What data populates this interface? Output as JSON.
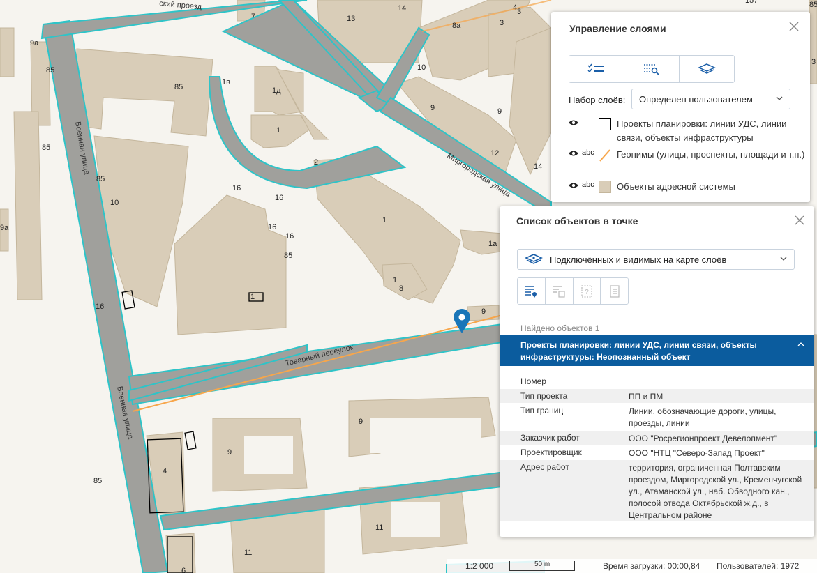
{
  "map": {
    "streets": [
      "Военная улица",
      "Военная улица",
      "Товарный переулок",
      "Миргородская улица",
      "ский проезд"
    ],
    "house_numbers": [
      "7",
      "13",
      "14",
      "8а",
      "3",
      "4",
      "3",
      "157",
      "9а",
      "85",
      "85",
      "85",
      "85",
      "16",
      "1в",
      "1д",
      "1",
      "2",
      "10",
      "16",
      "16",
      "16",
      "16",
      "85",
      "1",
      "1",
      "1",
      "8",
      "10",
      "9",
      "9",
      "12",
      "14",
      "1а",
      "9",
      "85",
      "9",
      "9",
      "4",
      "85",
      "11",
      "11",
      "6",
      "9а",
      "3"
    ]
  },
  "layers_panel": {
    "title": "Управление слоями",
    "set_label": "Набор слоёв:",
    "set_value": "Определен пользователем",
    "tools": [
      "checklist-icon",
      "filter-search-icon",
      "layers-icon"
    ],
    "layers": [
      {
        "label": "Проекты планировки: линии УДС, линии связи, объекты инфраструктуры",
        "abc": "",
        "legend_color": "#000000"
      },
      {
        "label": "Геонимы (улицы, проспекты, площади и т.п.)",
        "abc": "abc",
        "legend_color": "#f7a64b"
      },
      {
        "label": "Объекты адресной системы",
        "abc": "abc",
        "legend_color": "#d9cdb8"
      }
    ]
  },
  "objects_panel": {
    "title": "Список объектов в точке",
    "source_value": "Подключённых и видимых на карте слоёв",
    "found_label": "Найдено объектов 1",
    "result_header": "Проекты планировки: линии УДС, линии связи, объекты инфраструктуры: Неопознанный объект",
    "attributes": [
      {
        "key": "Номер",
        "value": ""
      },
      {
        "key": "Тип проекта",
        "value": "ПП и ПМ"
      },
      {
        "key": "Тип границ",
        "value": "Линии, обозначающие дороги, улицы, проезды, линии"
      },
      {
        "key": "Заказчик работ",
        "value": "ООО \"Росрегионпроект Девелопмент\""
      },
      {
        "key": "Проектировщик",
        "value": "ООО \"НТЦ \"Северо-Запад Проект\""
      },
      {
        "key": "Адрес работ",
        "value": "территория, ограниченная Полтавским проездом, Миргородской ул., Кременчугской ул., Атаманской ул., наб. Обводного кан., полосой отвода Октябрьской ж.д., в Центральном районе"
      }
    ],
    "accent": "#0b5c9e"
  },
  "status": {
    "scale": "1:2 000",
    "scale_bar": "50 m",
    "load_time": "Время загрузки: 00:00,84",
    "users": "Пользователей: 1972"
  }
}
